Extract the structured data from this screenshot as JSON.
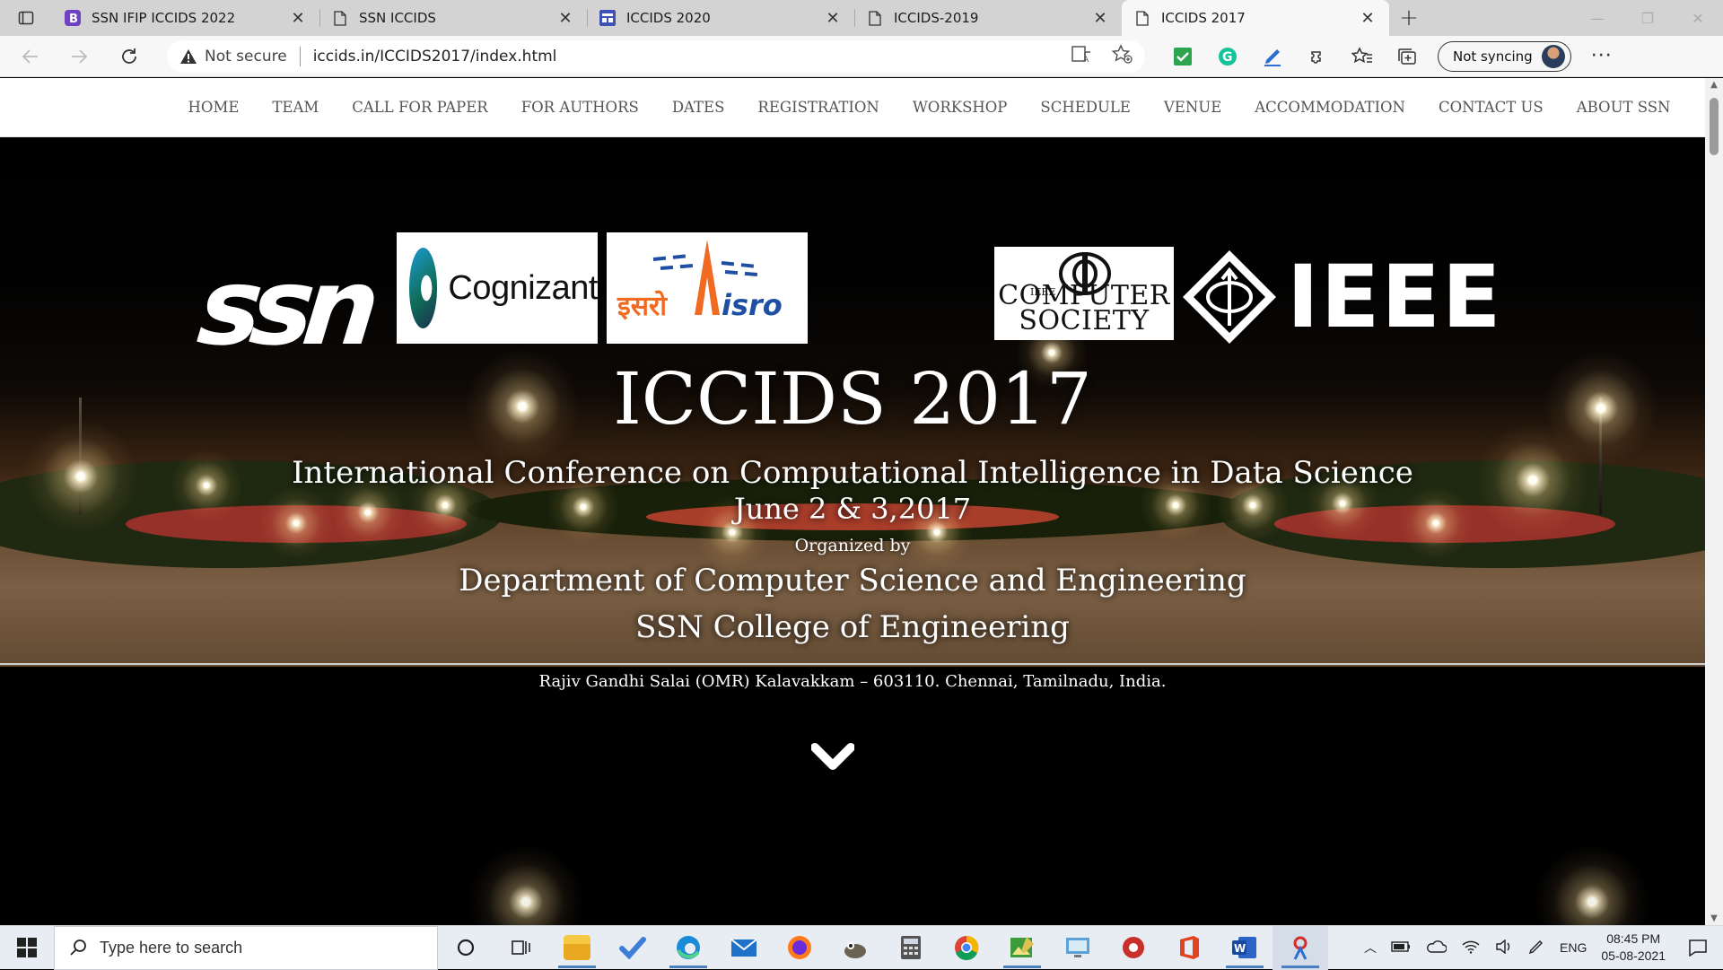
{
  "browser": {
    "tabs": [
      {
        "title": "SSN IFIP ICCIDS 2022",
        "icon": "bootstrap-icon",
        "active": false
      },
      {
        "title": "SSN ICCIDS",
        "icon": "page-icon",
        "active": false
      },
      {
        "title": "ICCIDS 2020",
        "icon": "site-icon",
        "active": false
      },
      {
        "title": "ICCIDS-2019",
        "icon": "page-icon",
        "active": false
      },
      {
        "title": "ICCIDS 2017",
        "icon": "page-icon",
        "active": true
      }
    ],
    "security_label": "Not secure",
    "url": "iccids.in/ICCIDS2017/index.html",
    "sync_label": "Not syncing"
  },
  "nav": {
    "items": [
      "HOME",
      "TEAM",
      "CALL FOR PAPER",
      "FOR AUTHORS",
      "DATES",
      "REGISTRATION",
      "WORKSHOP",
      "SCHEDULE",
      "VENUE",
      "ACCOMMODATION",
      "CONTACT US",
      "ABOUT SSN"
    ]
  },
  "logos": {
    "ssn": "ssn",
    "cognizant": "Cognizant",
    "isro_hindi": "इसरो",
    "isro": "isro",
    "cs_small": "IEEE",
    "cs_line1": "COMPUTER",
    "cs_line2": "SOCIETY",
    "ieee": "IEEE"
  },
  "hero": {
    "title": "ICCIDS 2017",
    "subtitle": "International Conference on Computational Intelligence in Data Science",
    "dates": "June 2 & 3,2017",
    "organized_by": "Organized by",
    "department": "Department of Computer Science and Engineering",
    "college": "SSN College of Engineering",
    "address": "Rajiv Gandhi Salai (OMR) Kalavakkam – 603110. Chennai, Tamilnadu, India."
  },
  "taskbar": {
    "search_placeholder": "Type here to search",
    "language": "ENG",
    "time": "08:45 PM",
    "date": "05-08-2021"
  },
  "colors": {
    "tabstrip": "#d3d3d3",
    "accent_blue": "#4a7fc1",
    "isro_orange": "#f06a22",
    "isro_blue": "#1f4fa3"
  }
}
